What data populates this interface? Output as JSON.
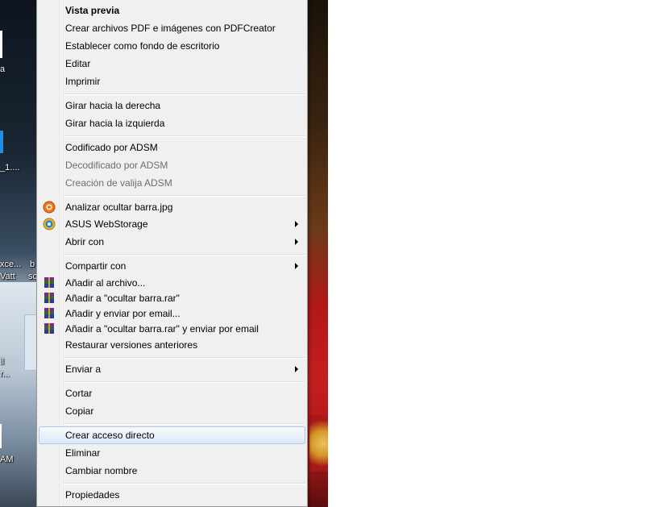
{
  "desktop": {
    "labels": [
      "a",
      "_1....",
      "xce...",
      "Vatt",
      "b",
      "sc",
      "il",
      "r...",
      "AM"
    ]
  },
  "menu": {
    "items": [
      {
        "label": "Vista previa"
      },
      {
        "label": "Crear archivos PDF e imágenes con PDFCreator"
      },
      {
        "label": "Establecer como fondo de escritorio"
      },
      {
        "label": "Editar"
      },
      {
        "label": "Imprimir"
      },
      {
        "label": "Girar hacia la derecha"
      },
      {
        "label": "Girar hacia la izquierda"
      },
      {
        "label": "Codificado por ADSM"
      },
      {
        "label": "Decodificado por ADSM"
      },
      {
        "label": "Creación de valija ADSM"
      },
      {
        "label": "Analizar ocultar barra.jpg",
        "icon": "antivirus-scan-icon"
      },
      {
        "label": "ASUS WebStorage",
        "icon": "asus-webstorage-icon"
      },
      {
        "label": "Abrir con"
      },
      {
        "label": "Compartir con"
      },
      {
        "label": "Añadir al archivo...",
        "icon": "winrar-icon"
      },
      {
        "label": "Añadir a \"ocultar barra.rar\"",
        "icon": "winrar-icon"
      },
      {
        "label": "Añadir y enviar por email...",
        "icon": "winrar-icon"
      },
      {
        "label": "Añadir a \"ocultar barra.rar\" y enviar por email",
        "icon": "winrar-icon"
      },
      {
        "label": "Restaurar versiones anteriores"
      },
      {
        "label": "Enviar a"
      },
      {
        "label": "Cortar"
      },
      {
        "label": "Copiar"
      },
      {
        "label": "Crear acceso directo"
      },
      {
        "label": "Eliminar"
      },
      {
        "label": "Cambiar nombre"
      },
      {
        "label": "Propiedades"
      }
    ]
  },
  "colors": {
    "menu_bg": "#f0f0f0",
    "highlight_border": "#a8c8ee",
    "disabled_text": "#6d6d6d"
  }
}
